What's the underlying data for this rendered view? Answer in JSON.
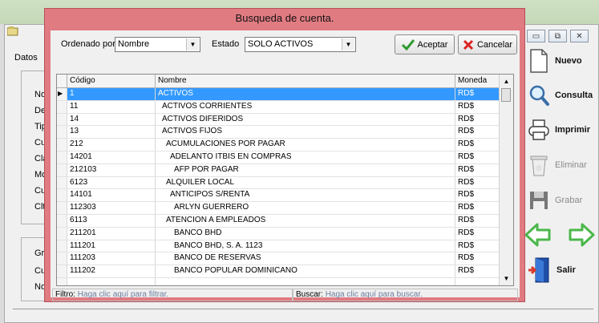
{
  "background_form": {
    "section_label": "Datos",
    "field_label_fragments": [
      "No",
      "De",
      "Tip",
      "Cu",
      "Cla",
      "Mo",
      "Cu",
      "Clt"
    ],
    "group2_label_fragments": [
      "Gr",
      "Cu",
      "No"
    ],
    "window_controls": [
      "▭",
      "⧉",
      "✕"
    ]
  },
  "side_buttons": [
    {
      "label": "Nuevo",
      "icon": "document-icon",
      "enabled": true
    },
    {
      "label": "Consulta",
      "icon": "magnifier-icon",
      "enabled": true
    },
    {
      "label": "Imprimir",
      "icon": "printer-icon",
      "enabled": true
    },
    {
      "label": "Eliminar",
      "icon": "trash-icon",
      "enabled": false
    },
    {
      "label": "Grabar",
      "icon": "floppy-disk-icon",
      "enabled": false
    },
    {
      "label": "Salir",
      "icon": "exit-door-icon",
      "enabled": true
    }
  ],
  "nav_arrows": {
    "prev": "arrow-left-icon",
    "next": "arrow-right-icon",
    "color": "#4bb74b"
  },
  "dialog": {
    "title": "Busqueda de cuenta.",
    "accent_color": "#e17b82",
    "order_label": "Ordenado por",
    "order_value": "Nombre",
    "state_label": "Estado",
    "state_value": "SOLO ACTIVOS",
    "accept_label": "Aceptar",
    "cancel_label": "Cancelar",
    "columns": [
      "Código",
      "Nombre",
      "Moneda"
    ],
    "selected_row_color": "#3399ff",
    "rows": [
      {
        "codigo": "1",
        "nombre": "ACTIVOS",
        "moneda": "RD$",
        "indent": 0,
        "selected": true
      },
      {
        "codigo": "11",
        "nombre": "ACTIVOS CORRIENTES",
        "moneda": "RD$",
        "indent": 1
      },
      {
        "codigo": "14",
        "nombre": "ACTIVOS DIFERIDOS",
        "moneda": "RD$",
        "indent": 1
      },
      {
        "codigo": "13",
        "nombre": "ACTIVOS FIJOS",
        "moneda": "RD$",
        "indent": 1
      },
      {
        "codigo": "212",
        "nombre": "ACUMULACIONES POR PAGAR",
        "moneda": "RD$",
        "indent": 2
      },
      {
        "codigo": "14201",
        "nombre": "ADELANTO ITBIS EN COMPRAS",
        "moneda": "RD$",
        "indent": 3
      },
      {
        "codigo": "212103",
        "nombre": "AFP POR PAGAR",
        "moneda": "RD$",
        "indent": 4
      },
      {
        "codigo": "6123",
        "nombre": "ALQUILER LOCAL",
        "moneda": "RD$",
        "indent": 2
      },
      {
        "codigo": "14101",
        "nombre": "ANTICIPOS S/RENTA",
        "moneda": "RD$",
        "indent": 3
      },
      {
        "codigo": "112303",
        "nombre": "ARLYN GUERRERO",
        "moneda": "RD$",
        "indent": 4
      },
      {
        "codigo": "6113",
        "nombre": "ATENCION A EMPLEADOS",
        "moneda": "RD$",
        "indent": 2
      },
      {
        "codigo": "211201",
        "nombre": "BANCO BHD",
        "moneda": "RD$",
        "indent": 4
      },
      {
        "codigo": "111201",
        "nombre": "BANCO BHD, S. A. 1123",
        "moneda": "RD$",
        "indent": 4
      },
      {
        "codigo": "111203",
        "nombre": "BANCO DE RESERVAS",
        "moneda": "RD$",
        "indent": 4
      },
      {
        "codigo": "111202",
        "nombre": "BANCO POPULAR DOMINICANO",
        "moneda": "RD$",
        "indent": 4
      },
      {
        "codigo": "",
        "nombre": "",
        "moneda": "",
        "indent": 0
      }
    ],
    "filter_label": "Filtro:",
    "filter_hint": "Haga clic aquí para filtrar.",
    "search_label": "Buscar:",
    "search_hint": "Haga clic aquí para buscar."
  }
}
